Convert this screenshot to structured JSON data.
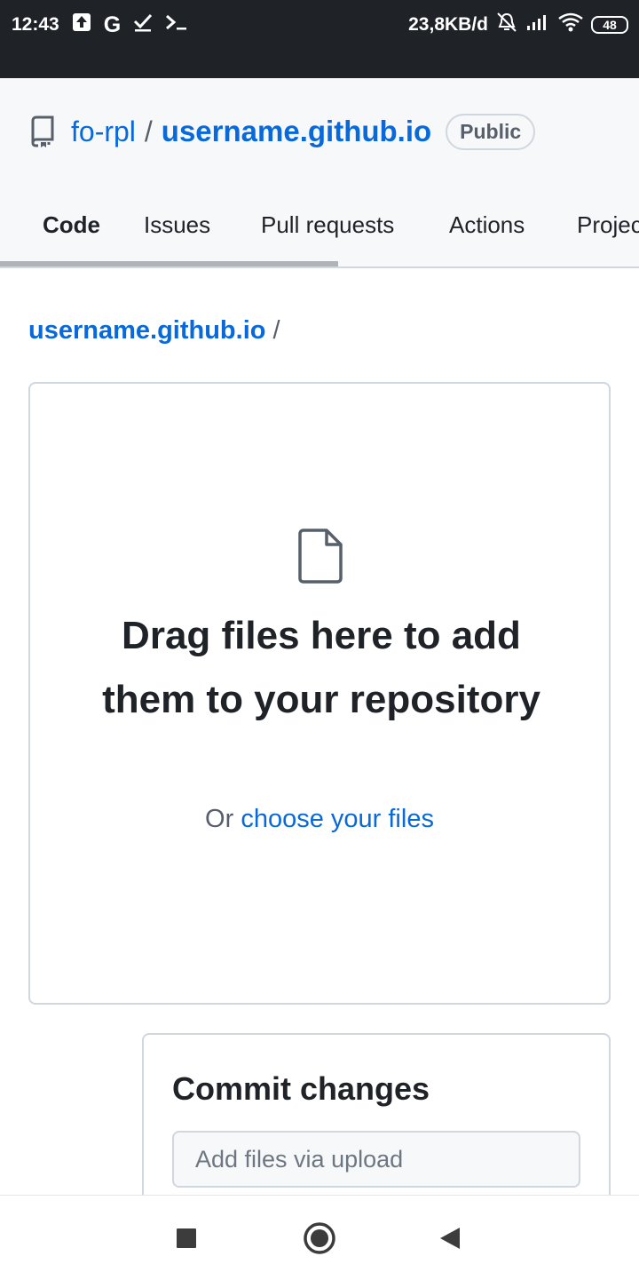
{
  "status_bar": {
    "time": "12:43",
    "left_icons": [
      "upload-icon",
      "g-icon",
      "check-icon",
      "terminal-icon"
    ],
    "g_letter": "G",
    "net_speed": "23,8KB/d",
    "right_icons": [
      "mute-icon",
      "signal-icon",
      "wifi-icon"
    ],
    "battery": "48"
  },
  "repo": {
    "owner": "fo-rpl",
    "separator": "/",
    "name": "username.github.io",
    "visibility": "Public",
    "icon": "repo-icon"
  },
  "tabs": [
    {
      "label": "Code",
      "active": true
    },
    {
      "label": "Issues",
      "active": false
    },
    {
      "label": "Pull requests",
      "active": false
    },
    {
      "label": "Actions",
      "active": false
    },
    {
      "label": "Projec",
      "active": false
    }
  ],
  "breadcrumb": {
    "repo": "username.github.io",
    "separator": "/"
  },
  "dropzone": {
    "icon": "file-icon",
    "title": "Drag files here to add them to your repository",
    "sub_prefix": "Or",
    "sub_link": "choose your files"
  },
  "commit": {
    "title": "Commit changes",
    "placeholder": "Add files via upload"
  },
  "nav": {
    "buttons": [
      "recents-icon",
      "home-icon",
      "back-icon"
    ]
  },
  "colors": {
    "link": "#0969da",
    "text": "#1f2328",
    "muted": "#57606a",
    "border": "#d0d7de",
    "header_bg": "#f6f8fa",
    "active_tab_underline": "#fd8c73",
    "status_bar_bg": "#1f2328"
  }
}
